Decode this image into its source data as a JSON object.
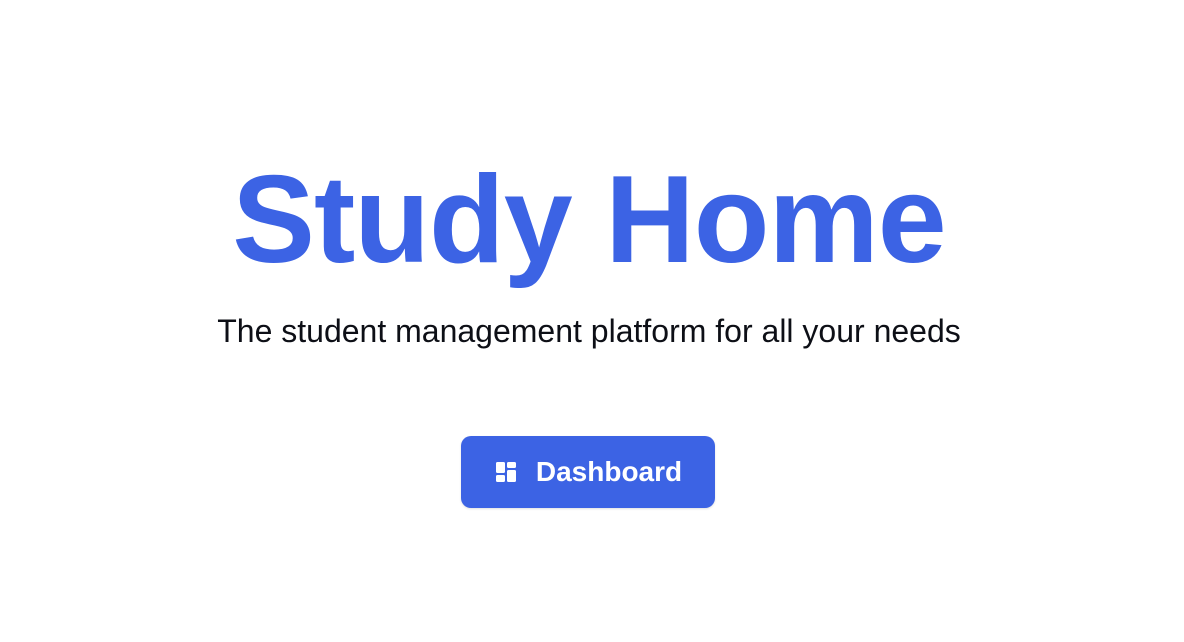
{
  "hero": {
    "title": "Study Home",
    "subtitle": "The student management platform for all your needs"
  },
  "dashboard_button": {
    "label": "Dashboard",
    "icon": "dashboard-icon"
  },
  "colors": {
    "accent": "#3c63e4",
    "text": "#0d0f16",
    "background": "#ffffff",
    "button_text": "#ffffff"
  }
}
